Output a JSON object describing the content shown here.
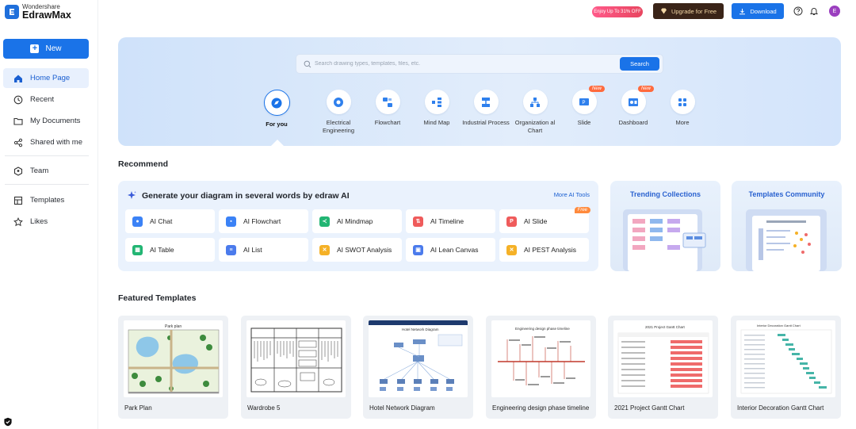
{
  "brand": {
    "small": "Wondershare",
    "big": "EdrawMax"
  },
  "sidebar": {
    "new_label": "New",
    "items": [
      {
        "label": "Home Page",
        "icon": "home-icon"
      },
      {
        "label": "Recent",
        "icon": "clock-icon"
      },
      {
        "label": "My Documents",
        "icon": "folder-icon"
      },
      {
        "label": "Shared with me",
        "icon": "share-icon"
      },
      {
        "label": "Team",
        "icon": "team-icon"
      },
      {
        "label": "Templates",
        "icon": "templates-icon"
      },
      {
        "label": "Likes",
        "icon": "star-icon"
      }
    ]
  },
  "topbar": {
    "promo": "Enjoy Up To 31% OFF",
    "upgrade": "Upgrade for Free",
    "download": "Download",
    "avatar_initial": "E"
  },
  "search": {
    "placeholder": "Search drawing types, templates, files, etc.",
    "button": "Search"
  },
  "categories": [
    {
      "label": "For you",
      "active": true
    },
    {
      "label": "Electrical Engineering"
    },
    {
      "label": "Flowchart"
    },
    {
      "label": "Mind Map"
    },
    {
      "label": "Industrial Process"
    },
    {
      "label": "Organization al Chart"
    },
    {
      "label": "Slide",
      "badge": "New"
    },
    {
      "label": "Dashboard",
      "badge": "New"
    },
    {
      "label": "More"
    }
  ],
  "recommend": {
    "title": "Recommend",
    "ai_heading": "Generate your diagram in several words by edraw AI",
    "ai_more": "More AI Tools",
    "ai_tools": [
      {
        "label": "AI Chat",
        "color": "#3b82f6"
      },
      {
        "label": "AI Flowchart",
        "color": "#3b82f6"
      },
      {
        "label": "AI Mindmap",
        "color": "#22b573"
      },
      {
        "label": "AI Timeline",
        "color": "#ef5b5b"
      },
      {
        "label": "AI Slide",
        "color": "#ef5b5b",
        "badge": "Free"
      },
      {
        "label": "AI Table",
        "color": "#22b573"
      },
      {
        "label": "AI List",
        "color": "#4b7bec"
      },
      {
        "label": "AI SWOT Analysis",
        "color": "#f5b127"
      },
      {
        "label": "AI Lean Canvas",
        "color": "#4b7bec"
      },
      {
        "label": "AI PEST Analysis",
        "color": "#f5b127"
      }
    ],
    "promo_cards": [
      "Trending Collections",
      "Templates Community"
    ]
  },
  "featured": {
    "title": "Featured Templates",
    "templates": [
      {
        "label": "Park Plan",
        "thumb_title": "Park plan"
      },
      {
        "label": "Wardrobe 5",
        "thumb_title": ""
      },
      {
        "label": "Hotel Network Diagram",
        "thumb_title": "Hotel Network Diagram"
      },
      {
        "label": "Engineering design phase timeline",
        "thumb_title": "Engineering design phase timeline"
      },
      {
        "label": "2021 Project Gantt Chart",
        "thumb_title": "2021 Project Gantt Chart"
      },
      {
        "label": "Interior Decoration Gantt Chart",
        "thumb_title": "Interior Decoration Gantt Chart"
      }
    ]
  }
}
